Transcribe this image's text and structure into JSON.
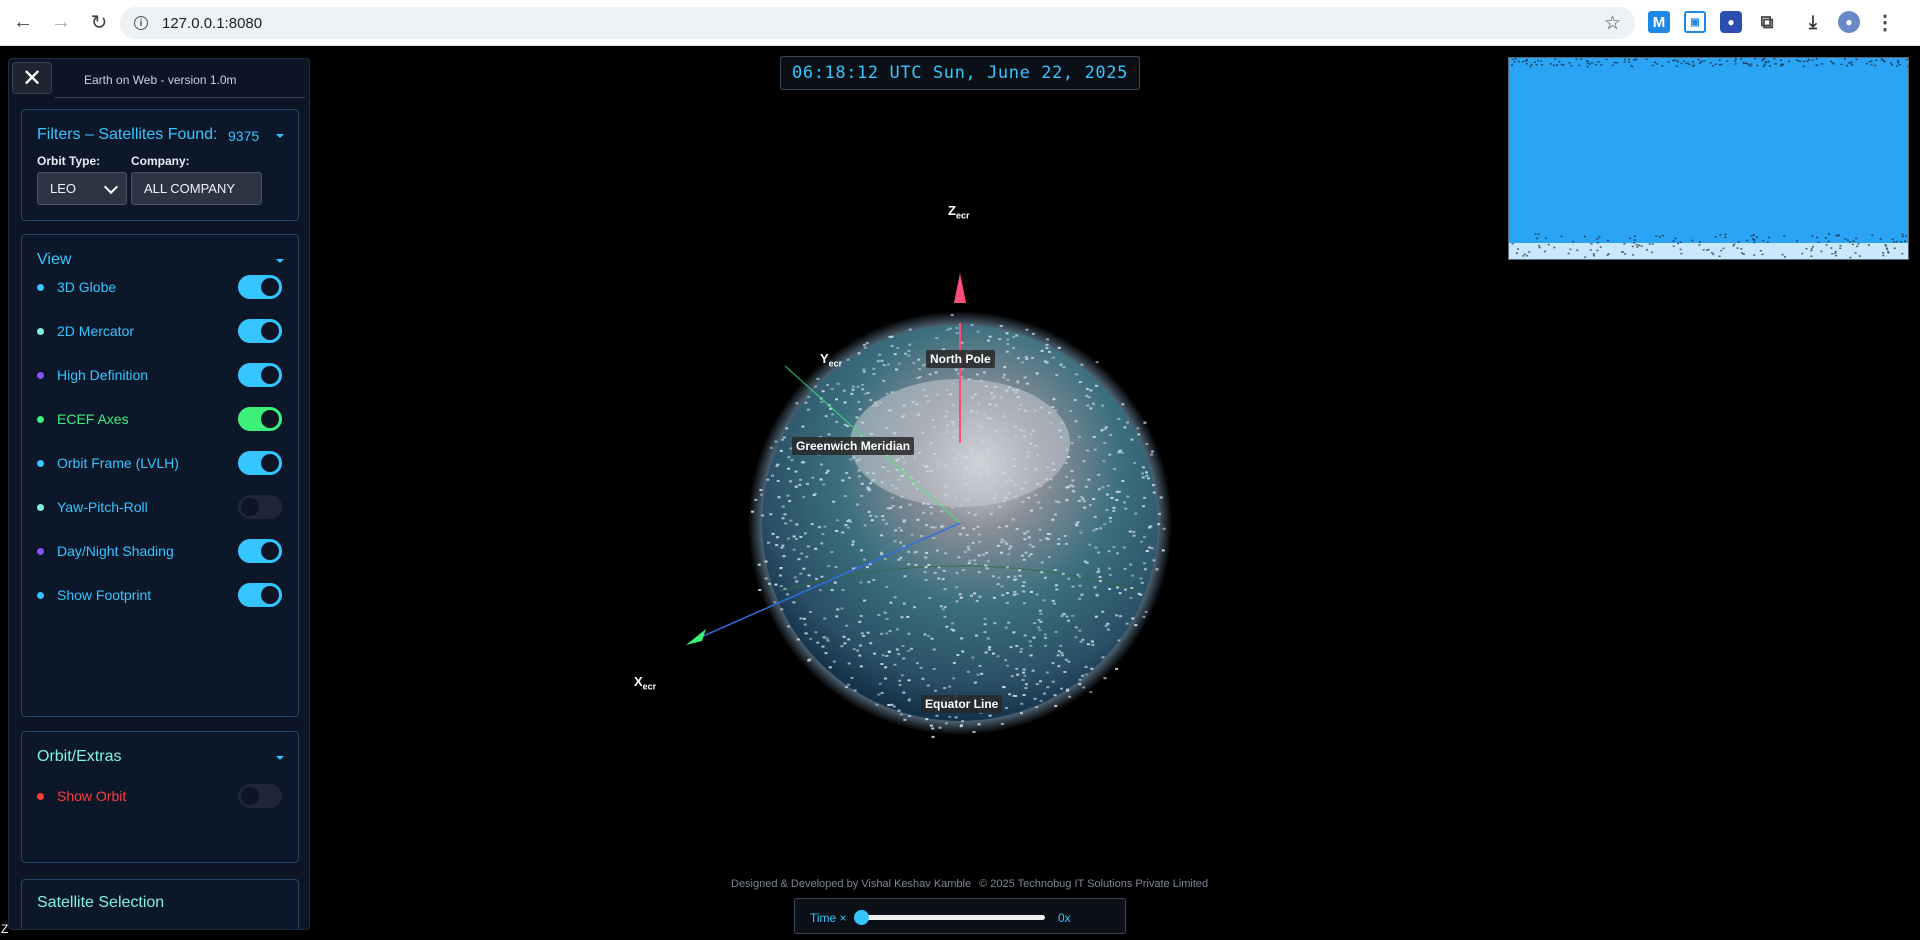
{
  "browser": {
    "url": "127.0.0.1:8080"
  },
  "sidebar": {
    "close_label": "✕",
    "app_version": "Earth on Web - version 1.0m",
    "filters": {
      "title": "Filters – Satellites Found:",
      "count": "9375",
      "orbit_type_label": "Orbit Type:",
      "orbit_type_value": "LEO",
      "company_label": "Company:",
      "company_value": "ALL COMPANY"
    },
    "view": {
      "title": "View",
      "items": [
        {
          "label": "3D Globe",
          "on": true,
          "color": "#35c6ff",
          "dot": "#35c6ff"
        },
        {
          "label": "2D Mercator",
          "on": true,
          "color": "#35c6ff",
          "dot": "#7ff2e2"
        },
        {
          "label": "High Definition",
          "on": true,
          "color": "#35c6ff",
          "dot": "#8e4ff0"
        },
        {
          "label": "ECEF Axes",
          "on": true,
          "color": "#3cf07a",
          "dot": "#3cf07a"
        },
        {
          "label": "Orbit Frame (LVLH)",
          "on": true,
          "color": "#35c6ff",
          "dot": "#35c6ff"
        },
        {
          "label": "Yaw-Pitch-Roll",
          "on": false,
          "color": "#35c6ff",
          "dot": "#7ff2e2"
        },
        {
          "label": "Day/Night Shading",
          "on": true,
          "color": "#35c6ff",
          "dot": "#8e4ff0"
        },
        {
          "label": "Show Footprint",
          "on": true,
          "color": "#35c6ff",
          "dot": "#35c6ff"
        }
      ]
    },
    "extras": {
      "title": "Orbit/Extras",
      "items": [
        {
          "label": "Show Orbit",
          "on": false,
          "color": "#ff3b3b",
          "dot": "#ff3b3b"
        }
      ]
    },
    "selection": {
      "title": "Satellite Selection"
    }
  },
  "time_display": "06:18:12 UTC Sun, June 22, 2025",
  "globe": {
    "labels": {
      "z_axis": "Z",
      "y_axis": "Y",
      "x_axis": "X",
      "axis_sub": "ecr",
      "north_pole": "North Pole",
      "greenwich": "Greenwich Meridian",
      "equator": "Equator Line"
    }
  },
  "footer": {
    "credit": "Designed & Developed by Vishal Keshav Kamble",
    "copyright": "© 2025 Technobug IT Solutions Private Limited",
    "time_label": "Time ×",
    "time_value": "0x",
    "time_multiplier": 0
  },
  "corner_label": "Z"
}
